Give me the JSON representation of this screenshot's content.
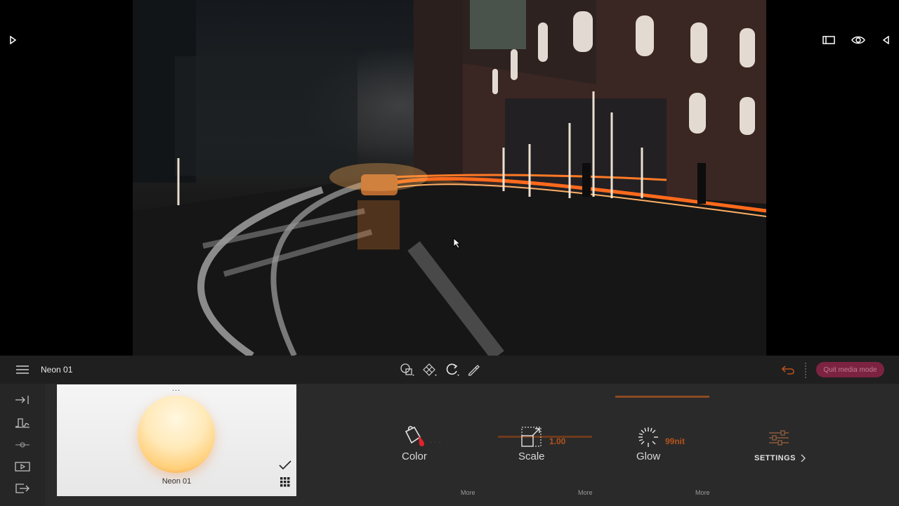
{
  "layer": {
    "name": "Neon 01"
  },
  "toolbar": {
    "quit_label": "Quit media mode"
  },
  "thumbnail": {
    "menu": "...",
    "label": "Neon 01"
  },
  "controls": {
    "color": {
      "label": "Color",
      "more": "More"
    },
    "scale": {
      "label": "Scale",
      "value": "1.00",
      "more": "More"
    },
    "glow": {
      "label": "Glow",
      "value": "99nit",
      "more": "More"
    }
  },
  "settings": {
    "label": "SETTINGS"
  },
  "colors": {
    "accent": "#b5531d",
    "quit_bg": "#7b2340",
    "panel_bg": "#2a2a2a",
    "bar_bg": "#1f1f1f"
  }
}
